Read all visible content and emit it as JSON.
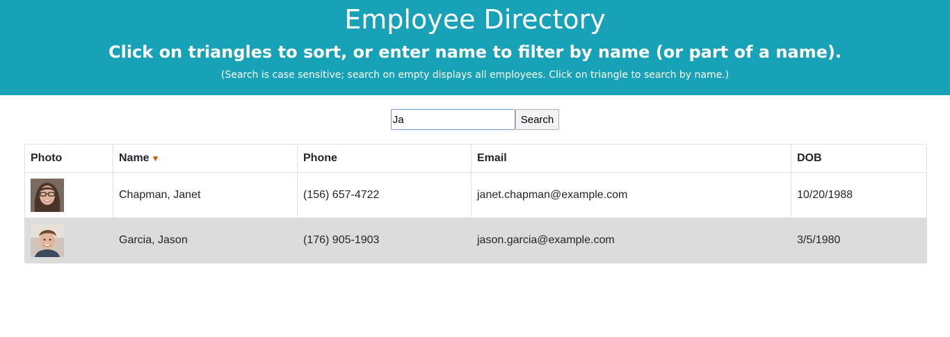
{
  "header": {
    "title": "Employee Directory",
    "subtitle": "Click on triangles to sort, or enter name to filter by name (or part of a name).",
    "note": "(Search is case sensitive; search on empty displays all employees. Click on triangle to search by name.)"
  },
  "search": {
    "value": "Ja",
    "button_label": "Search"
  },
  "table": {
    "columns": [
      "Photo",
      "Name",
      "Phone",
      "Email",
      "DOB"
    ],
    "sorted_column": "Name",
    "sort_icon": "triangle-down-icon",
    "rows": [
      {
        "name": "Chapman, Janet",
        "phone": "(156) 657-4722",
        "email": "janet.chapman@example.com",
        "dob": "10/20/1988"
      },
      {
        "name": "Garcia, Jason",
        "phone": "(176) 905-1903",
        "email": "jason.garcia@example.com",
        "dob": "3/5/1980"
      }
    ]
  },
  "colors": {
    "header_bg": "#18a2b8",
    "sort_arrow": "#cc5500",
    "alt_row_bg": "#dcdcdc"
  }
}
